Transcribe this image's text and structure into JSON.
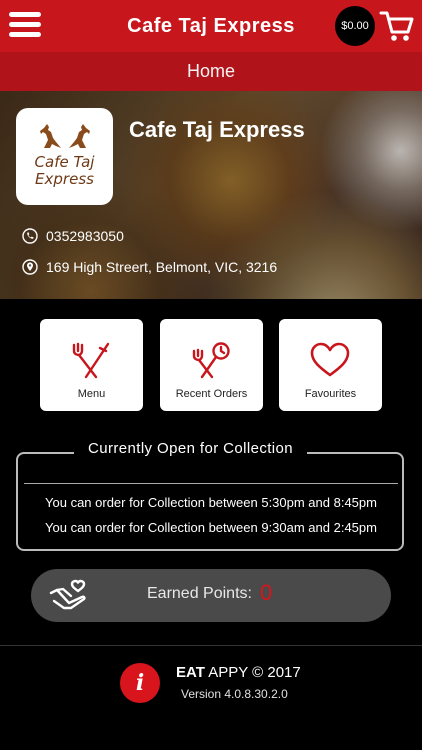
{
  "header": {
    "title": "Cafe Taj Express",
    "cart_total": "$0.00",
    "menu_icon": "hamburger-menu-icon",
    "cart_icon": "shopping-cart-icon",
    "accent_color": "#c8161d"
  },
  "subheader": {
    "title": "Home"
  },
  "restaurant": {
    "logo_text_line1": "Cafe Taj",
    "logo_text_line2": "Express",
    "name": "Cafe Taj Express",
    "phone": "0352983050",
    "address": "169 High Streert, Belmont, VIC, 3216",
    "phone_icon": "phone-icon",
    "address_icon": "location-pin-icon"
  },
  "tiles": [
    {
      "label": "Menu",
      "icon": "fork-knife-icon"
    },
    {
      "label": "Recent Orders",
      "icon": "fork-knife-clock-icon"
    },
    {
      "label": "Favourites",
      "icon": "heart-icon"
    }
  ],
  "open_status": {
    "title": "Currently Open for Collection",
    "lines": [
      "You can order for Collection between 5:30pm and 8:45pm",
      "You can order for Collection between 9:30am and 2:45pm"
    ]
  },
  "points": {
    "label": "Earned Points:",
    "value": "0",
    "icon": "hand-heart-icon",
    "value_color": "#d8141c"
  },
  "footer": {
    "info_glyph": "i",
    "brand_eat": "EAT",
    "brand_rest": "APPY © 2017",
    "version": "Version 4.0.8.30.2.0"
  }
}
